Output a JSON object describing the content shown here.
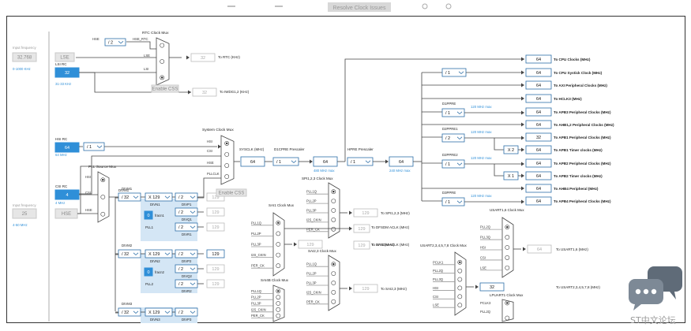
{
  "topbar": {
    "button_label": "Resolve Clock Issues"
  },
  "left": {
    "lse": {
      "label": "LSE",
      "input_label": "Input frequency",
      "value": "32.768",
      "range": "0-1000 KHz"
    },
    "lsi": {
      "label": "LSI RC",
      "value": "32",
      "note": "31-33 KHz"
    },
    "hsi": {
      "label": "HSI RC",
      "value": "64",
      "note": "64 MHz"
    },
    "csi": {
      "label": "CSI RC",
      "value": "4",
      "note": "4 MHz"
    },
    "hse": {
      "label": "HSE",
      "input_label": "Input frequency",
      "value": "25",
      "range": "4-50 MHz"
    }
  },
  "rtc": {
    "title": "RTC Clock Mux",
    "hse_div": "/ 2",
    "hse_rtc": "HSE_RTC",
    "in_hse": "HSE",
    "in_lse": "LSE",
    "in_lsi": "LSI",
    "rtc_value": "32",
    "rtc_label": "To RTC (KHz)",
    "iwdg_value": "32",
    "iwdg_label": "To IWDG1,2 (KHz)",
    "enable_css": "Enable CSS"
  },
  "pll_source": {
    "title": "PLL Source Mux",
    "in_hsi": "HSI",
    "in_csi": "CSI",
    "in_hse": "HSE",
    "hsi_div": "/ 1"
  },
  "pll1": {
    "divm": "DIVM1",
    "divm_val": "/ 32",
    "divn_val": "X 129",
    "divn": "DIVN1",
    "divp_val": "/ 2",
    "divp": "DIVP1",
    "divq_val": "/ 2",
    "divq": "DIVQ1",
    "divr_val": "/ 2",
    "divr": "DIVR1",
    "frac": "fracn1",
    "frac_val": "0",
    "name": "PLL1",
    "p_out": "129",
    "q_out": "129",
    "r_out": "129"
  },
  "pll2": {
    "divm": "DIVM2",
    "divm_val": "/ 32",
    "divn_val": "X 129",
    "divn": "DIVN2",
    "divp_val": "/ 2",
    "divp": "DIVP2",
    "divq_val": "/ 2",
    "divq": "DIVQ2",
    "divr_val": "/ 2",
    "divr": "DIVR2",
    "frac": "fracn2",
    "frac_val": "0",
    "name": "PLL2",
    "p_out": "129",
    "q_out": "129",
    "r_out": "129"
  },
  "pll3": {
    "divm": "DIVM3",
    "divm_val": "/ 32",
    "divn_val": "X 129",
    "divn": "DIVN3",
    "divp_val": "/ 2",
    "divp": "DIVP3"
  },
  "sysclk": {
    "title": "System Clock Mux",
    "in_hsi": "HSI",
    "in_csi": "CSI",
    "in_hse": "HSE",
    "in_pll": "PLLCLK",
    "enable_css": "Enable CSS",
    "sysclk_label": "SYSCLK (MHz)",
    "sysclk_val": "64",
    "d1cpre_label": "D1CPRE Prescaler",
    "d1cpre_val": "/ 1",
    "d1_out": "64",
    "d1_max": "480 MHz max",
    "hpre_label": "HPRE Prescaler",
    "hpre_val": "/ 1",
    "hpre_out": "64",
    "hpre_max": "240 MHz max"
  },
  "outputs": {
    "cpu": {
      "value": "64",
      "label": "To CPU Clocks (MHz)"
    },
    "systick_div": "/ 1",
    "systick": {
      "value": "64",
      "label": "To CPU Systick Clock (MHz)"
    },
    "axi": {
      "value": "64",
      "label": "To AXI Peripheral Clocks (MHz)"
    },
    "hclk3": {
      "value": "64",
      "label": "To HCLK3 (MHz)"
    },
    "d1ppre": {
      "label": "D1PPRE",
      "max": "120 MHz max",
      "div": "/ 1"
    },
    "apb3": {
      "value": "64",
      "label": "To APB3 Peripheral Clocks (MHz)"
    },
    "ahb12": {
      "value": "64",
      "label": "To AHB1,2 Peripheral Clocks (MHz)"
    },
    "d2ppre1": {
      "label": "D2PPRE1",
      "max": "120 MHz max",
      "div": "/ 2"
    },
    "apb1": {
      "value": "32",
      "label": "To APB1 Peripheral Clocks (MHz)"
    },
    "apb1_timer_mul": "X 2",
    "apb1_timer": {
      "value": "64",
      "label": "To APB1 Timer clocks (MHz)"
    },
    "d2ppre2": {
      "label": "D2PPRE2",
      "max": "120 MHz max",
      "div": "/ 1"
    },
    "apb2": {
      "value": "64",
      "label": "To APB2 Peripheral Clocks (MHz)"
    },
    "apb2_timer_mul": "X 1",
    "apb2_timer": {
      "value": "64",
      "label": "To APB2 Timer clocks (MHz)"
    },
    "ahb4": {
      "value": "64",
      "label": "To AHB4 Peripheral (MHz)"
    },
    "d3ppre": {
      "label": "D3PPRE",
      "max": "120 MHz max",
      "div": "/ 1"
    },
    "apb4": {
      "value": "64",
      "label": "To APB4 Peripheral Clocks (MHz)"
    }
  },
  "spi123": {
    "title": "SPI1,2,3 Clock Mux",
    "inputs": [
      "PLL1Q",
      "PLL2P",
      "PLL3P",
      "I2S_CKIN",
      "PER_CK"
    ],
    "value": "129",
    "label": "To SPI1,2,3 (MHz)"
  },
  "sai1": {
    "title": "SAI1 Clock Mux",
    "inputs": [
      "PLL1Q",
      "PLL2P",
      "PLL3P",
      "I2S_CKIN",
      "PER_CK"
    ],
    "value": "129",
    "label": "To DFSDM ACLK (MHz)"
  },
  "sai1_out": {
    "value": "129",
    "label": "To SAI1 (MHz)"
  },
  "sai23": {
    "title": "SAI2,3 Clock Mux",
    "inputs": [
      "PLL1Q",
      "PLL2P",
      "PLL3P",
      "I2S_CKIN",
      "PER_CK"
    ],
    "value": "129",
    "label": "To SAI2,3 (MHz)"
  },
  "sai4": {
    "title": "SAI4B Clock Mux",
    "inputs": [
      "PLL1Q",
      "PLL2P",
      "PLL3P",
      "I2S_CKIN",
      "PER_CK"
    ]
  },
  "usart16": {
    "title": "USART1,6 Clock Mux",
    "inputs": [
      "PLL2Q",
      "PLL3Q",
      "HSI",
      "CSI",
      "LSE"
    ],
    "value": "64",
    "label": "To USART1,6 (MHz)"
  },
  "usart2": {
    "title": "USART2,3,4,5,7,8 Clock Mux",
    "inputs": [
      "PCLK1",
      "PLL2Q",
      "PLL3Q",
      "HSI",
      "CSI",
      "LSE"
    ],
    "value": "32",
    "label": "To USART2,3,4,5,7,8 (MHz)"
  },
  "lpuart1": {
    "title": "LPUART1 Clock Mux",
    "inputs": [
      "PCLK3",
      "PLL2Q"
    ]
  },
  "watermark": "ST中文论坛"
}
